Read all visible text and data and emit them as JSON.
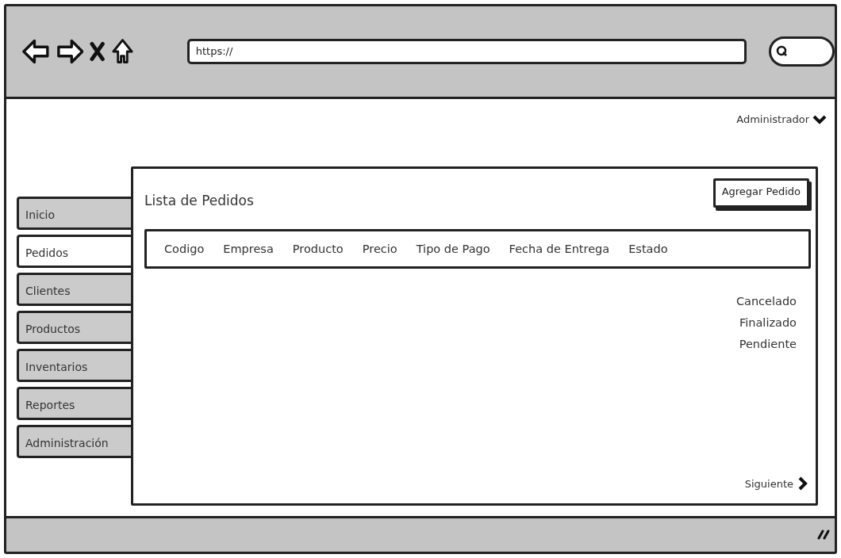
{
  "browser": {
    "url": "https://"
  },
  "user_menu": {
    "label": "Administrador"
  },
  "sidebar": {
    "items": [
      {
        "label": "Inicio",
        "selected": false
      },
      {
        "label": "Pedidos",
        "selected": true
      },
      {
        "label": "Clientes",
        "selected": false
      },
      {
        "label": "Productos",
        "selected": false
      },
      {
        "label": "Inventarios",
        "selected": false
      },
      {
        "label": "Reportes",
        "selected": false
      },
      {
        "label": "Administración",
        "selected": false
      }
    ]
  },
  "panel": {
    "title": "Lista de Pedidos",
    "add_button": "Agregar Pedido",
    "table": {
      "columns": [
        "Codigo",
        "Empresa",
        "Producto",
        "Precio",
        "Tipo de Pago",
        "Fecha de Entrega",
        "Estado"
      ],
      "status_values": [
        "Cancelado",
        "Finalizado",
        "Pendiente"
      ]
    },
    "next_link": "Siguiente"
  }
}
